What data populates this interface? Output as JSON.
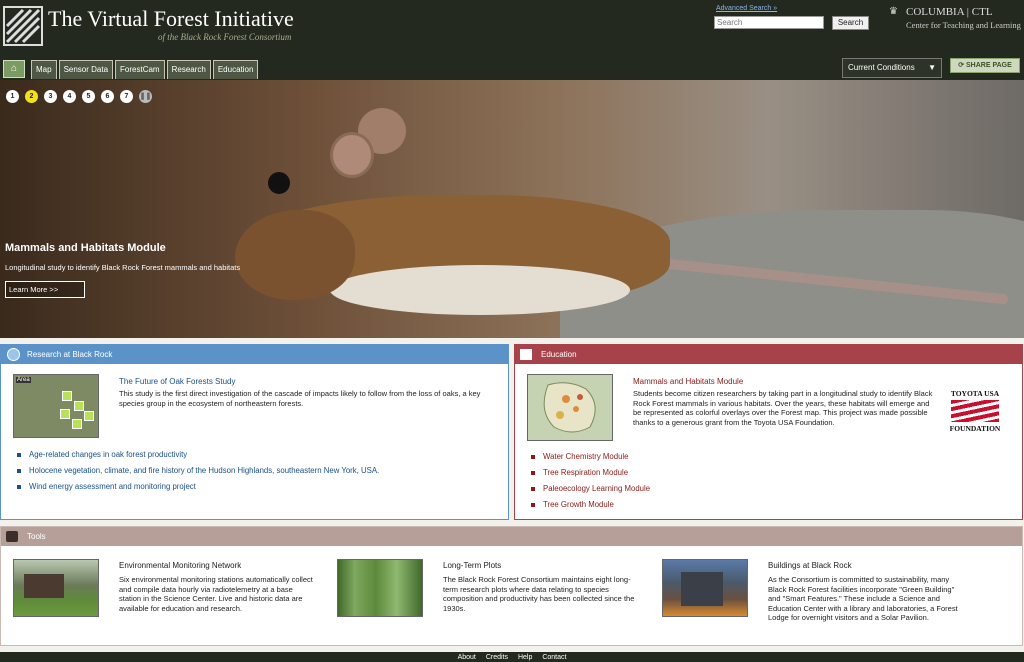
{
  "header": {
    "title": "The Virtual Forest Initiative",
    "subtitle": "of the Black Rock Forest Consortium",
    "advanced_search": "Advanced Search »",
    "search_placeholder": "Search",
    "search_button": "Search",
    "partner_name": "COLUMBIA | CTL",
    "partner_sub": "Center for Teaching and Learning"
  },
  "nav": {
    "items": [
      "Map",
      "Sensor Data",
      "ForestCam",
      "Research",
      "Education"
    ],
    "current_conditions": "Current Conditions",
    "share": "SHARE PAGE"
  },
  "hero": {
    "slides": [
      "1",
      "2",
      "3",
      "4",
      "5",
      "6",
      "7"
    ],
    "active_slide": "2",
    "title": "Mammals and Habitats Module",
    "description": "Longitudinal study to identify Black Rock Forest mammals and habitats",
    "cta": "Learn More >>"
  },
  "research": {
    "heading": "Research at Black Rock",
    "feature_title": "The Future of Oak Forests Study",
    "feature_body": "This study is the first direct investigation of the cascade of impacts likely to follow from the loss of oaks, a key species group in the ecosystem of northeastern forests.",
    "map_label": "Area",
    "links": [
      "Age-related changes in oak forest productivity",
      "Holocene vegetation, climate, and fire history of the Hudson Highlands, southeastern New York, USA.",
      "Wind energy assessment and monitoring project"
    ]
  },
  "education": {
    "heading": "Education",
    "feature_title": "Mammals and Habitats Module",
    "feature_body": "Students become citizen researchers by taking part in a longitudinal study to identify Black Rock Forest mammals in various habitats. Over the years, these habitats will emerge and be represented as colorful overlays over the Forest map. This project was made possible thanks to a generous grant from the Toyota USA Foundation.",
    "sponsor_top": "TOYOTA USA",
    "sponsor_bottom": "FOUNDATION",
    "links": [
      "Water Chemistry Module",
      "Tree Respiration Module",
      "Paleoecology Learning Module",
      "Tree Growth Module"
    ]
  },
  "tools": {
    "heading": "Tools",
    "items": [
      {
        "title": "Environmental Monitoring Network",
        "body": "Six environmental monitoring stations automatically collect and compile data hourly via radiotelemetry at a base station in the Science Center. Live and historic data are available for education and research."
      },
      {
        "title": "Long-Term Plots",
        "body": "The Black Rock Forest Consortium maintains eight long-term research plots where data relating to species composition and productivity has been collected since the 1930s."
      },
      {
        "title": "Buildings at Black Rock",
        "body": "As the Consortium is committed to sustainability, many Black Rock Forest facilities incorporate \"Green Building\" and \"Smart Features.\" These include a Science and Education Center with a library and laboratories, a Forest Lodge for overnight visitors and a Solar Pavilion."
      }
    ]
  },
  "footer": {
    "links": [
      "About",
      "Credits",
      "Help",
      "Contact"
    ]
  },
  "colors": {
    "header_bg": "#23291f",
    "research_accent": "#5b93c9",
    "education_accent": "#a8424a",
    "tools_accent": "#b59f98",
    "active_dot": "#f3e21a"
  }
}
